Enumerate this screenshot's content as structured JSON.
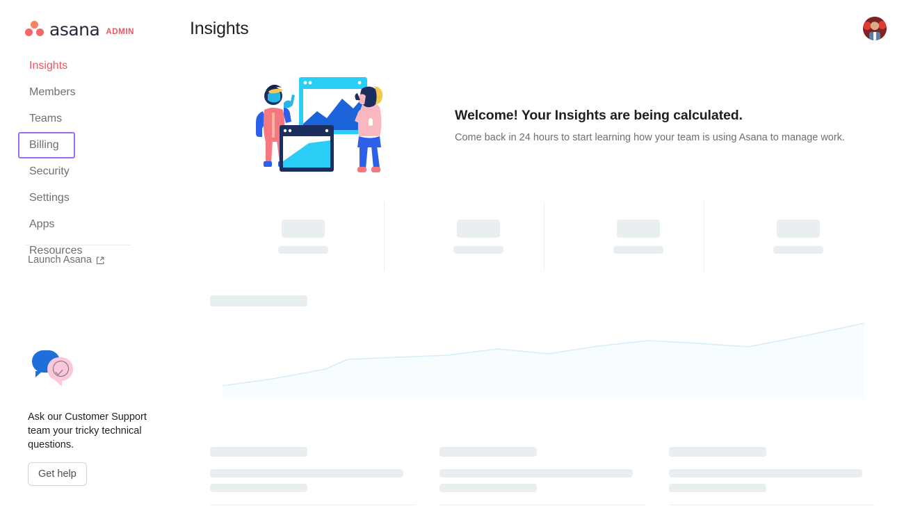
{
  "brand": {
    "logo_icon": "asana-logo-icon",
    "wordmark": "asana",
    "admin_label": "ADMIN",
    "dot_colors": [
      "#f06a6a",
      "#fc636b",
      "#fa8060"
    ],
    "wordmark_color": "#252a3c",
    "admin_color": "#f0555f"
  },
  "sidebar": {
    "items": [
      {
        "label": "Insights",
        "active": true,
        "focused": false
      },
      {
        "label": "Members",
        "active": false,
        "focused": false
      },
      {
        "label": "Teams",
        "active": false,
        "focused": false
      },
      {
        "label": "Billing",
        "active": false,
        "focused": true
      },
      {
        "label": "Security",
        "active": false,
        "focused": false
      },
      {
        "label": "Settings",
        "active": false,
        "focused": false
      },
      {
        "label": "Apps",
        "active": false,
        "focused": false
      },
      {
        "label": "Resources",
        "active": false,
        "focused": false
      }
    ],
    "launch": {
      "label": "Launch Asana",
      "icon": "external-link-icon"
    },
    "active_color": "#f0555f",
    "focus_ring_color": "#9b6bf2",
    "item_color": "#6b6f76"
  },
  "support": {
    "icon": "chat-bubbles-check-icon",
    "text": "Ask our Customer Support team your tricky technical questions.",
    "button_label": "Get help",
    "bubble_blue": "#1f6fdb",
    "bubble_pink": "#fcc7da"
  },
  "header": {
    "title": "Insights",
    "avatar": "user-avatar"
  },
  "welcome": {
    "illustration": "people-with-charts-illustration",
    "title": "Welcome! Your Insights are being calculated.",
    "subtitle": "Come back in 24 hours to start learning how your team is using Asana to manage work."
  },
  "skeleton": {
    "placeholder_color": "#e9eef0",
    "divider_color": "#eceff1",
    "stat_cards": [
      {
        "name": "stat-card-1"
      },
      {
        "name": "stat-card-2"
      },
      {
        "name": "stat-card-3"
      },
      {
        "name": "stat-card-4"
      }
    ],
    "bottom_columns": [
      {
        "name": "bottom-column-1"
      },
      {
        "name": "bottom-column-2"
      },
      {
        "name": "bottom-column-3"
      }
    ]
  },
  "chart_data": {
    "type": "area",
    "title": "",
    "xlabel": "",
    "ylabel": "",
    "line_color": "#d6eef9",
    "fill_color": "#f7fcfe",
    "grid": false,
    "legend": "none",
    "x": [
      0,
      1,
      2,
      3,
      4,
      5,
      6,
      7,
      8,
      9,
      10,
      11,
      12,
      13
    ],
    "values": [
      14,
      26,
      42,
      52,
      55,
      60,
      72,
      64,
      76,
      82,
      79,
      74,
      85,
      100
    ],
    "ylim": [
      0,
      100
    ],
    "note": "Placeholder loading chart rendered in very pale blue; no axis ticks or labels are displayed."
  }
}
